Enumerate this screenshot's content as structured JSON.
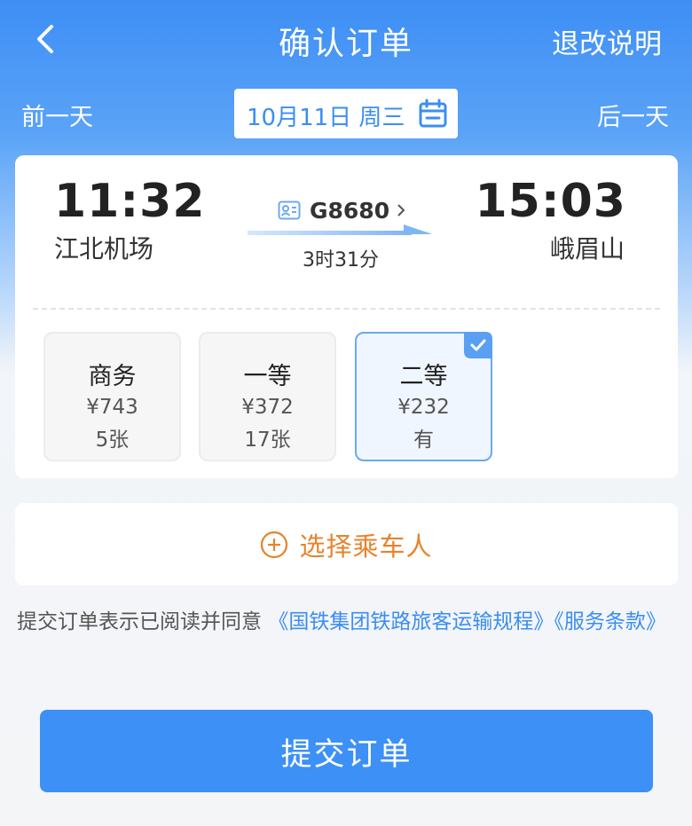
{
  "header": {
    "title": "确认订单",
    "refund_link": "退改说明",
    "back_icon": "chevron-left-icon"
  },
  "date_bar": {
    "prev_label": "前一天",
    "next_label": "后一天",
    "date": "10月11日 周三",
    "calendar_icon": "calendar-icon"
  },
  "train": {
    "departure_time": "11:32",
    "departure_station": "江北机场",
    "arrival_time": "15:03",
    "arrival_station": "峨眉山",
    "train_number": "G8680",
    "duration": "3时31分"
  },
  "seats": [
    {
      "name": "商务",
      "price": "¥743",
      "count": "5张",
      "selected": false
    },
    {
      "name": "一等",
      "price": "¥372",
      "count": "17张",
      "selected": false
    },
    {
      "name": "二等",
      "price": "¥232",
      "count": "有",
      "selected": true
    }
  ],
  "passenger": {
    "add_label": "选择乘车人"
  },
  "agreement": {
    "prefix": "提交订单表示已阅读并同意",
    "link_text": "《国铁集团铁路旅客运输规程》《服务条款》"
  },
  "submit": {
    "label": "提交订单"
  },
  "colors": {
    "primary": "#3d90f5",
    "accent_orange": "#e5832d",
    "link_blue": "#3b8ef2"
  }
}
